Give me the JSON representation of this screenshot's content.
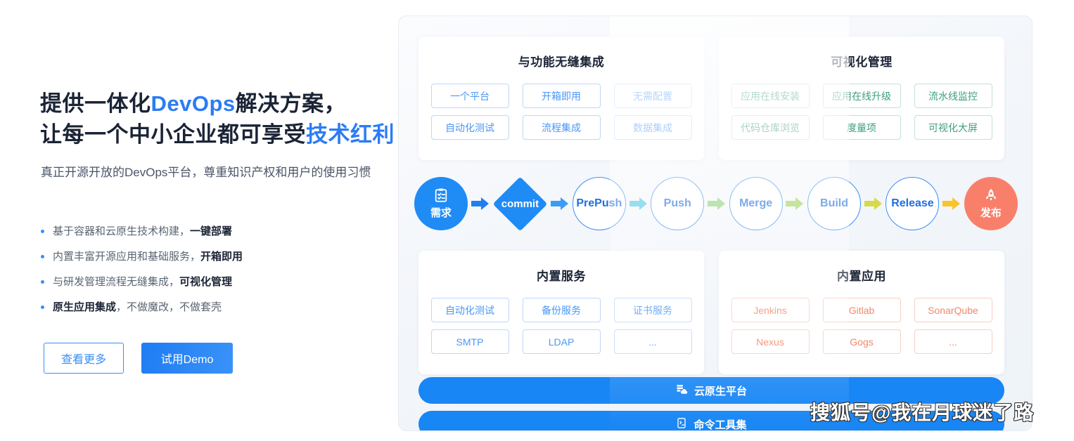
{
  "hero": {
    "headline_line1_pre": "提供一体化",
    "headline_line1_hl": "DevOps",
    "headline_line1_post": "解决方案，",
    "headline_line2_pre": "让每一个中小企业都可享受",
    "headline_line2_hl": "技术红利",
    "description": "真正开源开放的DevOps平台，尊重知识产权和用户的使用习惯",
    "bullets": [
      {
        "normal_pre": "基于容器和云原生技术构建，",
        "bold": "一键部署",
        "normal_post": ""
      },
      {
        "normal_pre": "内置丰富开源应用和基础服务，",
        "bold": "开箱即用",
        "normal_post": ""
      },
      {
        "normal_pre": "与研发管理流程无缝集成，",
        "bold": "可视化管理",
        "normal_post": ""
      },
      {
        "normal_pre": "",
        "bold": "原生应用集成",
        "normal_post": "，不做魔改，不做套壳"
      }
    ],
    "buttons": {
      "more_label": "查看更多",
      "demo_label": "试用Demo"
    }
  },
  "panel": {
    "cards": [
      {
        "title": "与功能无缝集成",
        "style": "tag-blue",
        "tags": [
          "一个平台",
          "开箱即用",
          "无需配置",
          "自动化测试",
          "流程集成",
          "数据集成"
        ]
      },
      {
        "title": "可视化管理",
        "style": "tag-green",
        "tags": [
          "应用在线安装",
          "应用在线升级",
          "流水线监控",
          "代码仓库浏览",
          "度量项",
          "可视化大屏"
        ]
      },
      {
        "title": "内置服务",
        "style": "tag-blue",
        "tags": [
          "自动化测试",
          "备份服务",
          "证书服务",
          "SMTP",
          "LDAP",
          "..."
        ]
      },
      {
        "title": "内置应用",
        "style": "tag-red",
        "tags": [
          "Jenkins",
          "Gitlab",
          "SonarQube",
          "Nexus",
          "Gogs",
          "..."
        ]
      }
    ],
    "pipeline": {
      "nodes": [
        {
          "type": "solid-blue",
          "label": "需求",
          "icon": "clipboard-check-icon"
        },
        {
          "type": "arrow",
          "color": "#1f7ff0"
        },
        {
          "type": "diamond",
          "label": "commit"
        },
        {
          "type": "arrow",
          "color": "#3b9cf7"
        },
        {
          "type": "outline",
          "label": "PrePush"
        },
        {
          "type": "arrow",
          "color": "#4fc7e3"
        },
        {
          "type": "outline",
          "label": "Push"
        },
        {
          "type": "arrow",
          "color": "#8fd07a"
        },
        {
          "type": "outline",
          "label": "Merge"
        },
        {
          "type": "arrow",
          "color": "#9ed05c"
        },
        {
          "type": "outline",
          "label": "Build"
        },
        {
          "type": "arrow",
          "color": "#d8d94a"
        },
        {
          "type": "outline",
          "label": "Release"
        },
        {
          "type": "arrow",
          "color": "#fbc42a"
        },
        {
          "type": "solid-red",
          "label": "发布",
          "icon": "rocket-icon"
        }
      ]
    },
    "bars": [
      {
        "label": "云原生平台",
        "icon": "cloud-server-icon"
      },
      {
        "label": "命令工具集",
        "icon": "terminal-icon"
      }
    ]
  },
  "watermark": {
    "text": "搜狐号@我在月球迷了路"
  },
  "colors": {
    "brand_blue": "#2b7cf5",
    "bar_blue": "#1886f5",
    "tag_blue_text": "#4a97f7",
    "tag_green_text": "#3e9e84",
    "tag_red_text": "#f2886a",
    "node_red": "#f8806a",
    "headline_dark": "#1b2436"
  }
}
